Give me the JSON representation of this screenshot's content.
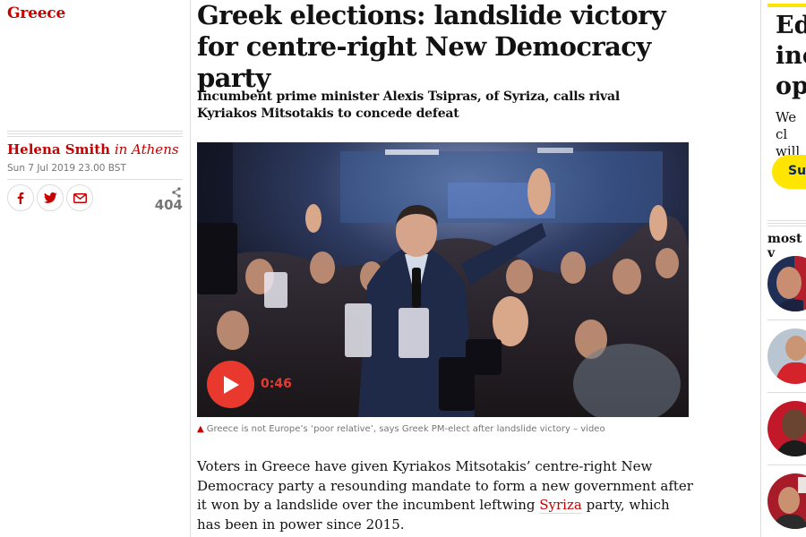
{
  "section": {
    "label": "Greece"
  },
  "byline": {
    "author": "Helena Smith",
    "location": "in Athens"
  },
  "dateline": "Sun 7 Jul 2019 23.00 BST",
  "share": {
    "buttons": [
      {
        "name": "facebook",
        "icon": "facebook-icon"
      },
      {
        "name": "twitter",
        "icon": "twitter-icon"
      },
      {
        "name": "email",
        "icon": "email-icon"
      }
    ],
    "count": "404",
    "count_icon": "share-icon"
  },
  "article": {
    "headline": "Greek elections: landslide victory for centre-right New Democracy party",
    "standfirst": "Incumbent prime minister Alexis Tsipras, of Syriza, calls rival Kyriakos Mitsotakis to concede defeat",
    "video": {
      "duration": "0:46",
      "play_icon": "play-icon"
    },
    "caption": "Greece is not Europe’s ‘poor relative’, says Greek PM-elect after landslide victory – video",
    "caption_icon": "video-triangle-icon",
    "body_before_link": "Voters in Greece have given Kyriakos Mitsotakis’ centre-right New Democracy party a resounding mandate to form a new government after it won by a landslide over the incumbent leftwing ",
    "body_link": "Syriza",
    "body_after_link": " party, which has been in power since 2015."
  },
  "epic": {
    "headline_lines": [
      "Ed",
      "inc",
      "op"
    ],
    "body_lines": [
      "We cl",
      "will y"
    ],
    "button_label": "Sup"
  },
  "most_popular": {
    "title": "most v"
  },
  "colors": {
    "accent": "#c70000",
    "support_yellow": "#ffe500",
    "text": "#121212",
    "muted": "#767676"
  }
}
